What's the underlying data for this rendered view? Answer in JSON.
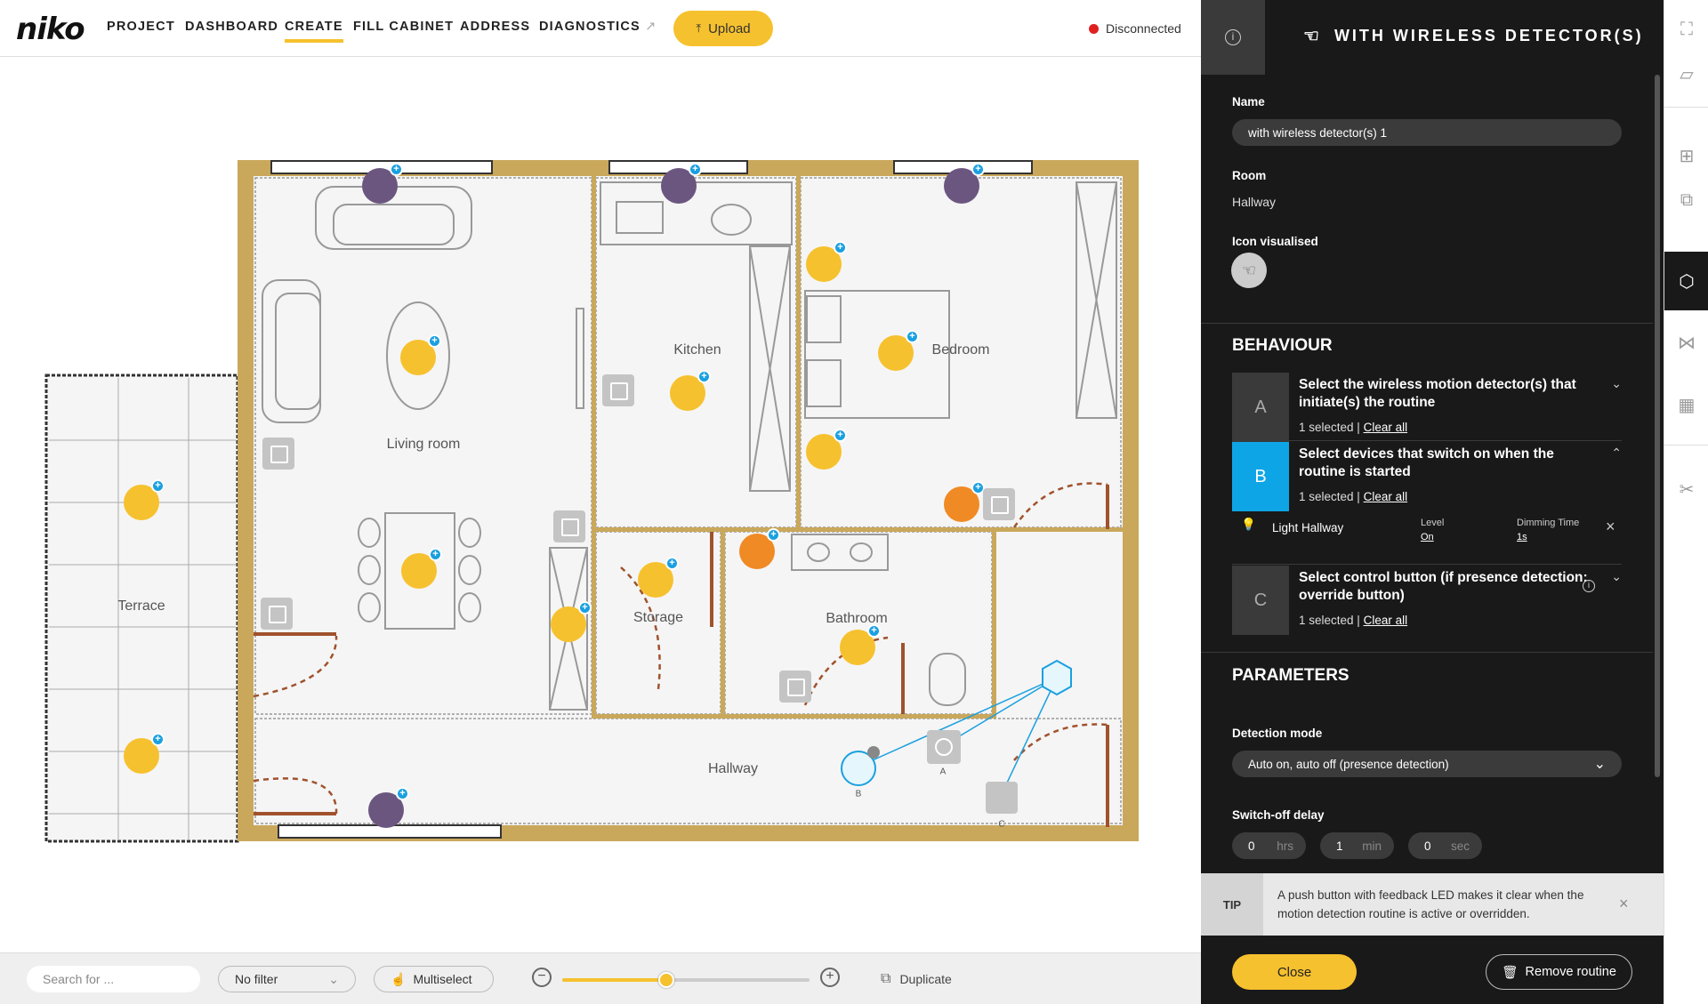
{
  "app": {
    "logo": "niko"
  },
  "nav": {
    "items": [
      "PROJECT",
      "DASHBOARD",
      "CREATE",
      "FILL CABINET",
      "ADDRESS",
      "DIAGNOSTICS"
    ],
    "active": "CREATE",
    "upload_label": "Upload",
    "status": "Disconnected",
    "status_color": "#e02020"
  },
  "floorplan": {
    "rooms": [
      "Living room",
      "Kitchen",
      "Bedroom",
      "Terrace",
      "Storage",
      "Bathroom",
      "Hallway"
    ],
    "device_labels": {
      "button": "A",
      "light": "B",
      "square": "C"
    },
    "accent_color": "#f6c12e",
    "wall_color": "#c9a85c"
  },
  "bottombar": {
    "search_placeholder": "Search for ...",
    "filter_value": "No filter",
    "multiselect_label": "Multiselect",
    "zoom_level": 0.42,
    "duplicate_label": "Duplicate"
  },
  "panel": {
    "title": "WITH WIRELESS DETECTOR(S)",
    "name_label": "Name",
    "name_value": "with wireless detector(s) 1",
    "room_label": "Room",
    "room_value": "Hallway",
    "icon_label": "Icon visualised",
    "behaviour_heading": "BEHAVIOUR",
    "steps": [
      {
        "letter": "A",
        "title": "Select the wireless motion detector(s) that initiate(s) the routine",
        "selected": "1 selected |",
        "clear": "Clear all"
      },
      {
        "letter": "B",
        "title": "Select devices that switch on when the routine is started",
        "selected": "1 selected |",
        "clear": "Clear all"
      },
      {
        "letter": "C",
        "title": "Select control button (if presence detection: override button)",
        "selected": "1 selected |",
        "clear": "Clear all"
      }
    ],
    "selected_device": {
      "name": "Light Hallway",
      "level_label": "Level",
      "level_value": "On",
      "dimming_label": "Dimming Time",
      "dimming_value": "1s"
    },
    "parameters_heading": "PARAMETERS",
    "detection_label": "Detection mode",
    "detection_value": "Auto on, auto off (presence detection)",
    "switchoff_label": "Switch-off delay",
    "delay": [
      {
        "value": "0",
        "unit": "hrs"
      },
      {
        "value": "1",
        "unit": "min"
      },
      {
        "value": "0",
        "unit": "sec"
      }
    ],
    "tip_label": "TIP",
    "tip_text": "A push button with feedback LED makes it clear when the motion detection routine is active or overridden.",
    "close_label": "Close",
    "remove_label": "Remove routine"
  }
}
